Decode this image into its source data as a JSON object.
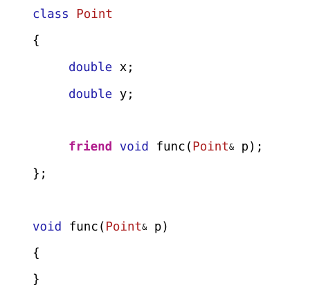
{
  "colors": {
    "keyword": "#1f1ca8",
    "type_name": "#aa1c1c",
    "friend_keyword": "#b01c8c",
    "plain": "#000000",
    "background": "#ffffff"
  },
  "code": {
    "line1": {
      "kw": "class",
      "type": "Point"
    },
    "line2": {
      "text": "{"
    },
    "line3": {
      "kw": "double",
      "text": "x;"
    },
    "line4": {
      "kw": "double",
      "text": "y;"
    },
    "line6": {
      "friend": "friend",
      "kw": "void",
      "func": "func(",
      "type": "Point",
      "amp": "&",
      "rest": "p);"
    },
    "line7": {
      "text": "};"
    },
    "line9": {
      "kw": "void",
      "func": "func(",
      "type": "Point",
      "amp": "&",
      "rest": "p)"
    },
    "line10": {
      "text": "{"
    },
    "line11": {
      "text": "}"
    }
  }
}
